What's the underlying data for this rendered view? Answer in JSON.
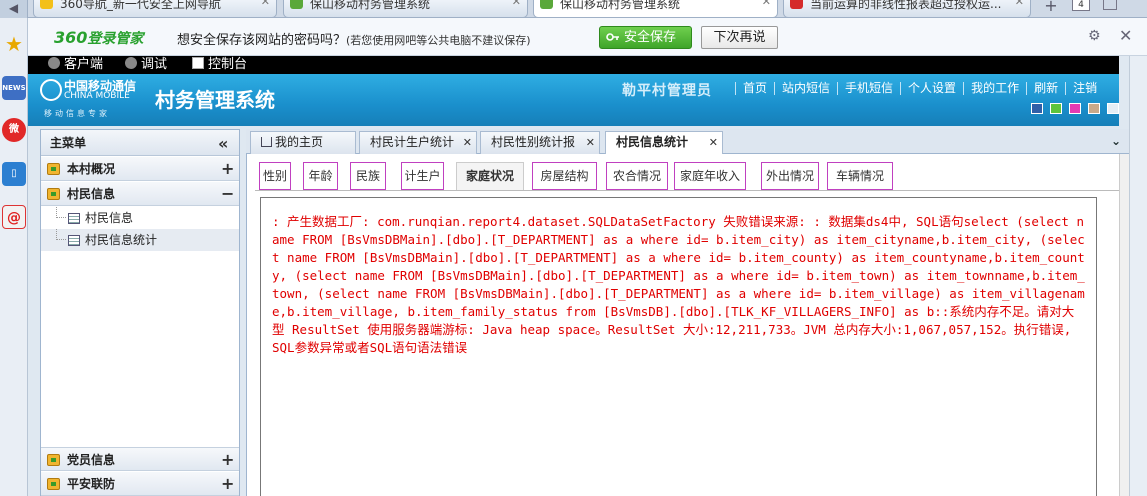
{
  "browser": {
    "tabs": [
      {
        "label": "360导航_新一代安全上网导航",
        "active": false
      },
      {
        "label": "保山移动村务管理系统",
        "active": false
      },
      {
        "label": "保山移动村务管理系统",
        "active": true
      },
      {
        "label": "当前运算的非线性报表超过授权运...",
        "active": false
      }
    ],
    "tab_count": "4"
  },
  "password_bar": {
    "logo_num": "360",
    "logo_text": "登录管家",
    "prompt": "想安全保存该网站的密码吗？",
    "note": "(若您使用网吧等公共电脑不建议保存)",
    "save_label": "安全保存",
    "later_label": "下次再说"
  },
  "devbar": {
    "client": "客户端",
    "debug": "调试",
    "console": "控制台"
  },
  "header": {
    "brand_cn": "中国移动通信",
    "brand_en": "CHINA MOBILE",
    "brand_sub": "移动信息专家",
    "title": "村务管理系统",
    "user": "勒平村管理员",
    "nav": [
      "首页",
      "站内短信",
      "手机短信",
      "个人设置",
      "我的工作",
      "刷新",
      "注销"
    ],
    "swatches": [
      "#2f5fa8",
      "#5ec43c",
      "#e43bb3",
      "#c9a98a",
      "#e6eef5"
    ]
  },
  "menu": {
    "title": "主菜单",
    "groups": [
      {
        "label": "本村概况",
        "toggle": "+"
      },
      {
        "label": "村民信息",
        "toggle": "−"
      },
      {
        "label": "党员信息",
        "toggle": "+"
      },
      {
        "label": "平安联防",
        "toggle": "+"
      }
    ],
    "subitems": [
      "村民信息",
      "村民信息统计"
    ]
  },
  "content_tabs": [
    {
      "label": "我的主页"
    },
    {
      "label": "村民计生户统计"
    },
    {
      "label": "村民性别统计报"
    },
    {
      "label": "村民信息统计"
    }
  ],
  "report_tabs": [
    "性别",
    "年龄",
    "民族",
    "计生户",
    "家庭状况",
    "房屋结构",
    "农合情况",
    "家庭年收入",
    "外出情况",
    "车辆情况"
  ],
  "error_message": ": 产生数据工厂: com.runqian.report4.dataset.SQLDataSetFactory 失败错误来源: : 数据集ds4中, SQL语句select (select name FROM [BsVmsDBMain].[dbo].[T_DEPARTMENT] as a where id= b.item_city) as item_cityname,b.item_city, (select name FROM [BsVmsDBMain].[dbo].[T_DEPARTMENT] as a where id= b.item_county) as item_countyname,b.item_county, (select name FROM [BsVmsDBMain].[dbo].[T_DEPARTMENT] as a where id= b.item_town) as item_townname,b.item_town, (select name FROM [BsVmsDBMain].[dbo].[T_DEPARTMENT] as a where id= b.item_village) as item_villagename,b.item_village, b.item_family_status from [BsVmsDB].[dbo].[TLK_KF_VILLAGERS_INFO] as b::系统内存不足。请对大型 ResultSet 使用服务器端游标: Java heap space。ResultSet 大小:12,211,733。JVM 总内存大小:1,067,057,152。执行错误, SQL参数异常或者SQL语句语法错误"
}
